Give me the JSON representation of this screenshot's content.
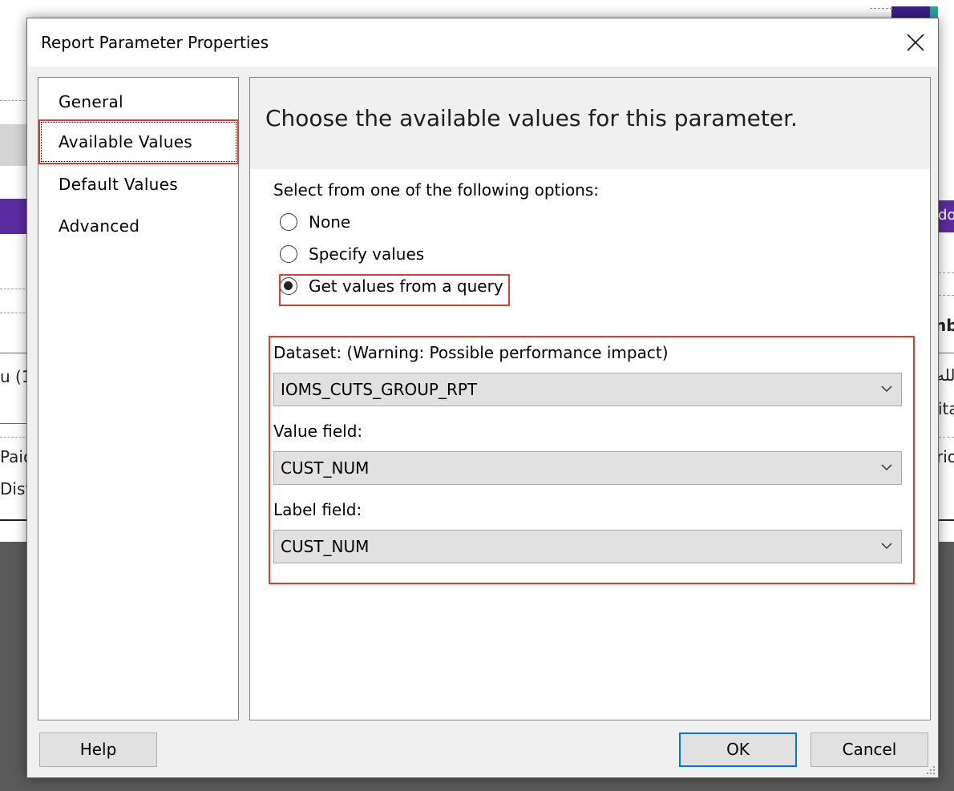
{
  "background": {
    "fragments": [
      "u (1",
      "Paid",
      "Dist",
      "nb",
      "لله",
      "ita",
      "rio",
      "do"
    ]
  },
  "dialog": {
    "title": "Report Parameter Properties",
    "close_icon": "close-icon"
  },
  "nav": {
    "items": [
      {
        "label": "General"
      },
      {
        "label": "Available Values"
      },
      {
        "label": "Default Values"
      },
      {
        "label": "Advanced"
      }
    ],
    "selected": "Available Values"
  },
  "content": {
    "heading": "Choose the available values for this parameter.",
    "options_label": "Select from one of the following options:",
    "options": [
      {
        "label": "None",
        "checked": false
      },
      {
        "label": "Specify values",
        "checked": false
      },
      {
        "label": "Get values from a query",
        "checked": true
      }
    ],
    "dataset": {
      "label": "Dataset: (Warning: Possible performance impact)",
      "value": "IOMS_CUTS_GROUP_RPT"
    },
    "value_field": {
      "label": "Value field:",
      "value": "CUST_NUM"
    },
    "label_field": {
      "label": "Label field:",
      "value": "CUST_NUM"
    }
  },
  "buttons": {
    "help": "Help",
    "ok": "OK",
    "cancel": "Cancel"
  },
  "colors": {
    "highlight": "#e03b2f",
    "accent": "#0078d7",
    "purple": "#5b2c9f"
  }
}
